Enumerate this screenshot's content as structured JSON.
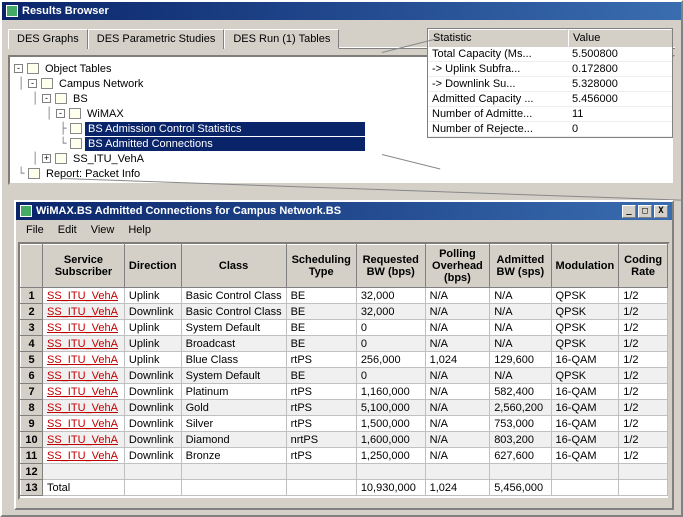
{
  "main_title": "Results Browser",
  "tabs": [
    "DES Graphs",
    "DES Parametric Studies",
    "DES Run (1) Tables"
  ],
  "tree": {
    "root": "Object Tables",
    "n1": "Campus Network",
    "n2": "BS",
    "n3": "WiMAX",
    "leaf1": "BS Admission Control Statistics",
    "leaf2": "BS Admitted Connections",
    "n4": "SS_ITU_VehA",
    "n5": "Report: Packet Info"
  },
  "stats": {
    "head_stat": "Statistic",
    "head_val": "Value",
    "rows": [
      {
        "k": "Total Capacity (Ms...",
        "v": "5.500800"
      },
      {
        "k": "-> Uplink Subfra...",
        "v": "0.172800"
      },
      {
        "k": "-> Downlink Su...",
        "v": "5.328000"
      },
      {
        "k": "Admitted Capacity ...",
        "v": "5.456000"
      },
      {
        "k": "Number of Admitte...",
        "v": "11"
      },
      {
        "k": "Number of Rejecte...",
        "v": "0"
      }
    ]
  },
  "sub_title": "WiMAX.BS Admitted Connections for Campus Network.BS",
  "menus": [
    "File",
    "Edit",
    "View",
    "Help"
  ],
  "cols": [
    "Service Subscriber",
    "Direction",
    "Class",
    "Scheduling Type",
    "Requested BW (bps)",
    "Polling Overhead (bps)",
    "Admitted BW (sps)",
    "Modulation",
    "Coding Rate"
  ],
  "rows": [
    {
      "n": "1",
      "sub": "SS_ITU_VehA",
      "dir": "Uplink",
      "cls": "Basic Control Class",
      "st": "BE",
      "req": "32,000",
      "pol": "N/A",
      "adm": "N/A",
      "mod": "QPSK",
      "cr": "1/2"
    },
    {
      "n": "2",
      "sub": "SS_ITU_VehA",
      "dir": "Downlink",
      "cls": "Basic Control Class",
      "st": "BE",
      "req": "32,000",
      "pol": "N/A",
      "adm": "N/A",
      "mod": "QPSK",
      "cr": "1/2"
    },
    {
      "n": "3",
      "sub": "SS_ITU_VehA",
      "dir": "Uplink",
      "cls": "System Default",
      "st": "BE",
      "req": "0",
      "pol": "N/A",
      "adm": "N/A",
      "mod": "QPSK",
      "cr": "1/2"
    },
    {
      "n": "4",
      "sub": "SS_ITU_VehA",
      "dir": "Uplink",
      "cls": "Broadcast",
      "st": "BE",
      "req": "0",
      "pol": "N/A",
      "adm": "N/A",
      "mod": "QPSK",
      "cr": "1/2"
    },
    {
      "n": "5",
      "sub": "SS_ITU_VehA",
      "dir": "Uplink",
      "cls": "Blue Class",
      "st": "rtPS",
      "req": "256,000",
      "pol": "1,024",
      "adm": "129,600",
      "mod": "16-QAM",
      "cr": "1/2"
    },
    {
      "n": "6",
      "sub": "SS_ITU_VehA",
      "dir": "Downlink",
      "cls": "System Default",
      "st": "BE",
      "req": "0",
      "pol": "N/A",
      "adm": "N/A",
      "mod": "QPSK",
      "cr": "1/2"
    },
    {
      "n": "7",
      "sub": "SS_ITU_VehA",
      "dir": "Downlink",
      "cls": "Platinum",
      "st": "rtPS",
      "req": "1,160,000",
      "pol": "N/A",
      "adm": "582,400",
      "mod": "16-QAM",
      "cr": "1/2"
    },
    {
      "n": "8",
      "sub": "SS_ITU_VehA",
      "dir": "Downlink",
      "cls": "Gold",
      "st": "rtPS",
      "req": "5,100,000",
      "pol": "N/A",
      "adm": "2,560,200",
      "mod": "16-QAM",
      "cr": "1/2"
    },
    {
      "n": "9",
      "sub": "SS_ITU_VehA",
      "dir": "Downlink",
      "cls": "Silver",
      "st": "rtPS",
      "req": "1,500,000",
      "pol": "N/A",
      "adm": "753,000",
      "mod": "16-QAM",
      "cr": "1/2"
    },
    {
      "n": "10",
      "sub": "SS_ITU_VehA",
      "dir": "Downlink",
      "cls": "Diamond",
      "st": "nrtPS",
      "req": "1,600,000",
      "pol": "N/A",
      "adm": "803,200",
      "mod": "16-QAM",
      "cr": "1/2"
    },
    {
      "n": "11",
      "sub": "SS_ITU_VehA",
      "dir": "Downlink",
      "cls": "Bronze",
      "st": "rtPS",
      "req": "1,250,000",
      "pol": "N/A",
      "adm": "627,600",
      "mod": "16-QAM",
      "cr": "1/2"
    }
  ],
  "total_label": "Total",
  "total": {
    "n": "13",
    "req": "10,930,000",
    "pol": "1,024",
    "adm": "5,456,000"
  },
  "empty_row": "12"
}
